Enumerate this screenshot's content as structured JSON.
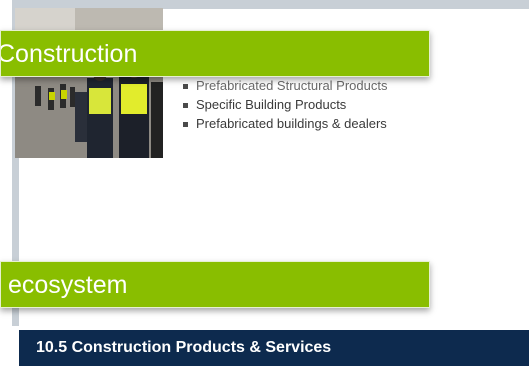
{
  "banners": {
    "top_title": "Construction",
    "bottom_title": "ecosystem"
  },
  "bullets": [
    "Prefabricated Structural Products",
    "Specific Building Products",
    "Prefabricated buildings & dealers"
  ],
  "footer": {
    "section_title": "10.5 Construction Products & Services"
  },
  "colors": {
    "banner_green": "#89be00",
    "footer_navy": "#0d2a4e",
    "frame_gray": "#c8cfd6"
  }
}
